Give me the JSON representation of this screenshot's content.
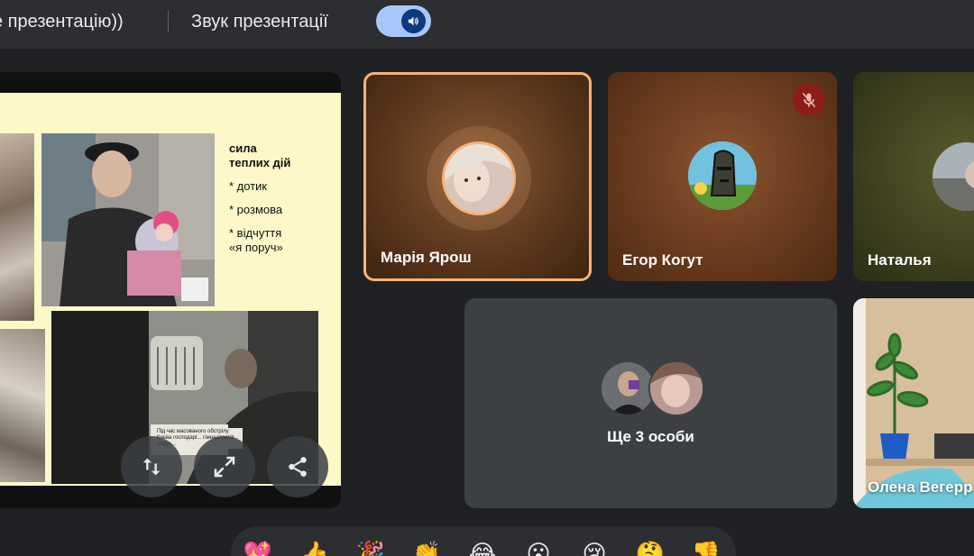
{
  "topbar": {
    "present_label": "е презентацію))",
    "sound_label": "Звук презентації",
    "toggle_icon": "volume-icon"
  },
  "slide": {
    "heading": "сила\nтеплих дій",
    "bullets": [
      "* дотик",
      "* розмова",
      "* відчуття\n«я поруч»"
    ],
    "small_caption": "Під час масованого обстрілу Києва господарі... гімнадпостів... поруч..."
  },
  "presentation_controls": [
    {
      "name": "swap-layout-button",
      "icon": "swap-vertical-icon"
    },
    {
      "name": "fullscreen-button",
      "icon": "expand-icon"
    },
    {
      "name": "share-button",
      "icon": "share-icon"
    }
  ],
  "participants": [
    {
      "id": "maria",
      "name": "Марія Ярош",
      "active_speaker": true,
      "muted": false
    },
    {
      "id": "egor",
      "name": "Егор Когут",
      "active_speaker": false,
      "muted": true
    },
    {
      "id": "natalia",
      "name": "Наталья",
      "active_speaker": false,
      "muted": false
    },
    {
      "id": "olena",
      "name": "Олена Вегерр",
      "active_speaker": false,
      "muted": false
    }
  ],
  "more_tile": {
    "label": "Ще 3 особи"
  },
  "reactions": [
    "💖",
    "👍",
    "🎉",
    "👏",
    "😂",
    "😮",
    "😢",
    "🤔",
    "👎"
  ],
  "colors": {
    "background": "#202124",
    "topbar": "#2d2e31",
    "toggle": "#a8c7fa",
    "speaker_border": "#f6b27a",
    "muted_badge": "#8c1d18",
    "slide": "#fef8c9"
  }
}
